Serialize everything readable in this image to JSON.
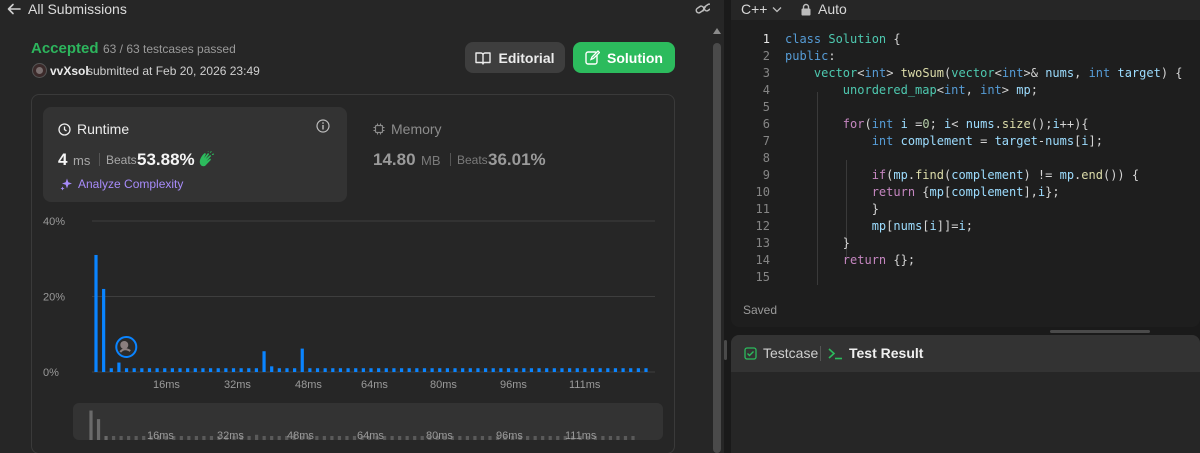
{
  "header": {
    "back_label": "All Submissions"
  },
  "submission": {
    "status": "Accepted",
    "testcases": "63 / 63 testcases passed",
    "user": "vvXsol",
    "submitted_text": "submitted at Feb 20, 2026 23:49"
  },
  "buttons": {
    "editorial": "Editorial",
    "solution": "Solution"
  },
  "runtime": {
    "title": "Runtime",
    "value": "4",
    "unit": "ms",
    "beats_label": "Beats",
    "beats_value": "53.88%",
    "analyze_label": "Analyze Complexity"
  },
  "memory": {
    "title": "Memory",
    "value": "14.80",
    "unit": "MB",
    "beats_label": "Beats",
    "beats_value": "36.01%"
  },
  "chart_data": {
    "type": "bar",
    "y_ticks": [
      "40%",
      "20%",
      "0%"
    ],
    "ylim": [
      0,
      40
    ],
    "x_ticks": [
      "16ms",
      "32ms",
      "48ms",
      "64ms",
      "80ms",
      "96ms",
      "111ms"
    ],
    "values": [
      31,
      22,
      1,
      2.5,
      1,
      1,
      1,
      1,
      1,
      1,
      1,
      1,
      1,
      1,
      1,
      1,
      1,
      1,
      1,
      1,
      1,
      1,
      5.5,
      1.5,
      1,
      1,
      1,
      6.2,
      1,
      1,
      1,
      1,
      1,
      1,
      1,
      1,
      1,
      1,
      1,
      1,
      1,
      1,
      1,
      1,
      1,
      1,
      1,
      1,
      1,
      1,
      1,
      1,
      1,
      1,
      1,
      1,
      1,
      1,
      1,
      1,
      1,
      1,
      1,
      1,
      1,
      1,
      1,
      1,
      1,
      1,
      1,
      1,
      1
    ],
    "highlight_index": 2,
    "bar_color": "#0a84ff",
    "grid": true
  },
  "minimap": {
    "x_ticks": [
      "16ms",
      "32ms",
      "48ms",
      "64ms",
      "80ms",
      "96ms",
      "111ms"
    ]
  },
  "editor": {
    "language": "C++",
    "mode": "Auto",
    "status": "Saved",
    "active_line": 1,
    "lines": [
      {
        "n": "1",
        "text": "class Solution {"
      },
      {
        "n": "2",
        "text": "public:"
      },
      {
        "n": "3",
        "text": "    vector<int> twoSum(vector<int>& nums, int target) {"
      },
      {
        "n": "4",
        "text": "        unordered_map<int, int> mp;"
      },
      {
        "n": "5",
        "text": ""
      },
      {
        "n": "6",
        "text": "        for(int i =0; i< nums.size();i++){"
      },
      {
        "n": "7",
        "text": "            int complement = target-nums[i];"
      },
      {
        "n": "8",
        "text": ""
      },
      {
        "n": "9",
        "text": "            if(mp.find(complement) != mp.end()) {"
      },
      {
        "n": "10",
        "text": "            return {mp[complement],i};"
      },
      {
        "n": "11",
        "text": "            }"
      },
      {
        "n": "12",
        "text": "            mp[nums[i]]=i;"
      },
      {
        "n": "13",
        "text": "        }"
      },
      {
        "n": "14",
        "text": "        return {};"
      },
      {
        "n": "15",
        "text": ""
      }
    ]
  },
  "bottom_tabs": {
    "testcase": "Testcase",
    "test_result": "Test Result"
  },
  "colors": {
    "accepted": "#2db55d",
    "solution_button": "#2cbb5d",
    "bar": "#0a84ff",
    "analyze": "#a78bfa"
  }
}
